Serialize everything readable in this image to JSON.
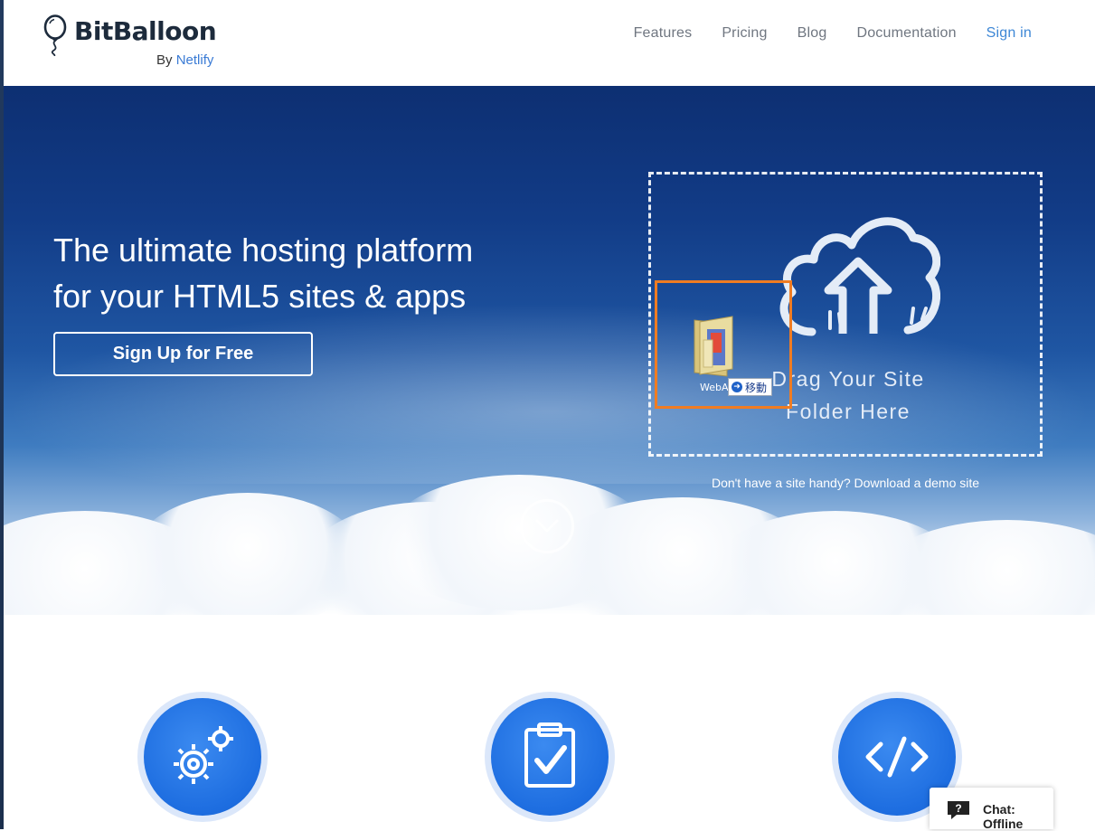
{
  "header": {
    "brand": "BitBalloon",
    "by_prefix": "By",
    "by_link": "Netlify",
    "nav": [
      {
        "label": "Features"
      },
      {
        "label": "Pricing"
      },
      {
        "label": "Blog"
      },
      {
        "label": "Documentation"
      },
      {
        "label": "Sign in"
      }
    ]
  },
  "hero": {
    "title_line1": "The ultimate hosting platform",
    "title_line2": "for your HTML5 sites & apps",
    "signup_label": "Sign Up for Free",
    "dropzone_line1": "Drag Your Site",
    "dropzone_line2": "Folder Here",
    "demo_prefix": "Don't have a site handy?",
    "demo_link": "Download a demo site"
  },
  "drag_overlay": {
    "filename": "WebA",
    "action_label": "移動",
    "highlight_color": "#f07c22"
  },
  "features": [
    {
      "icon": "gears-icon"
    },
    {
      "icon": "clipboard-check-icon"
    },
    {
      "icon": "code-icon"
    }
  ],
  "chat": {
    "label": "Chat: Offline"
  },
  "colors": {
    "accent": "#3d87d6",
    "feature_blue": "#1d6de0"
  }
}
